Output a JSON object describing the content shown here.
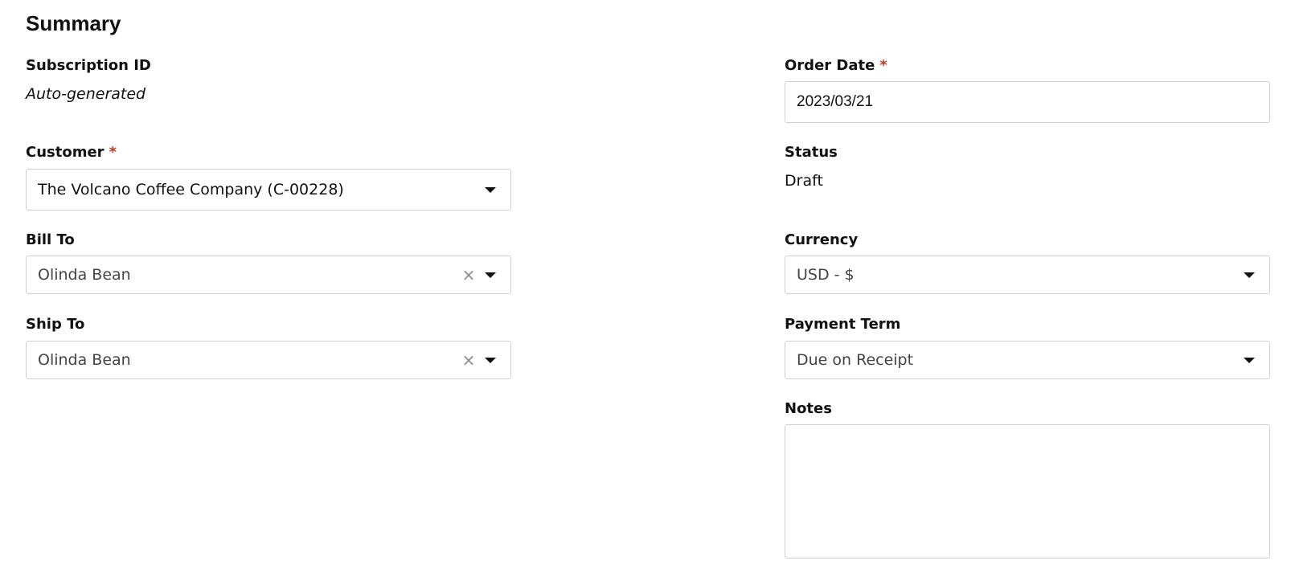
{
  "section": {
    "title": "Summary"
  },
  "subscription_id": {
    "label": "Subscription ID",
    "value": "Auto-generated"
  },
  "customer": {
    "label": "Customer",
    "required_mark": "*",
    "value": "The Volcano Coffee Company (C-00228)"
  },
  "bill_to": {
    "label": "Bill To",
    "value": "Olinda Bean",
    "clear_glyph": "×"
  },
  "ship_to": {
    "label": "Ship To",
    "value": "Olinda Bean",
    "clear_glyph": "×"
  },
  "order_date": {
    "label": "Order Date",
    "required_mark": "*",
    "value": "2023/03/21"
  },
  "status": {
    "label": "Status",
    "value": "Draft"
  },
  "currency": {
    "label": "Currency",
    "value": "USD - $"
  },
  "payment_term": {
    "label": "Payment Term",
    "value": "Due on Receipt"
  },
  "notes": {
    "label": "Notes",
    "value": ""
  },
  "icons": {
    "dropdown": "caret-down-icon",
    "clear": "clear-icon"
  },
  "colors": {
    "required": "#c0392b",
    "border": "#cfcfcf"
  }
}
